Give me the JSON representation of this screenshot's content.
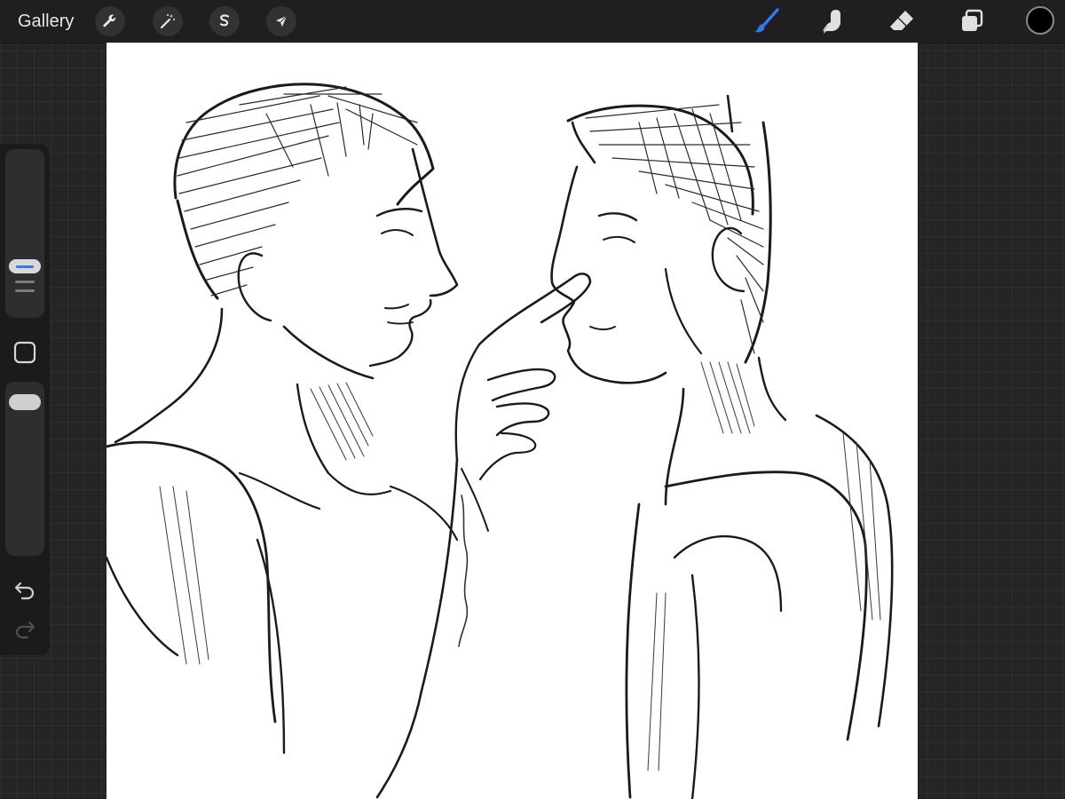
{
  "topbar": {
    "gallery_label": "Gallery",
    "left_tools": [
      {
        "name": "actions",
        "icon": "wrench-icon"
      },
      {
        "name": "adjustments",
        "icon": "magic-wand-icon"
      },
      {
        "name": "selection",
        "icon": "selection-s-icon"
      },
      {
        "name": "transform",
        "icon": "arrow-cursor-icon"
      }
    ],
    "right_tools": [
      {
        "name": "brush",
        "icon": "brush-icon",
        "active": true
      },
      {
        "name": "smudge",
        "icon": "smudge-finger-icon"
      },
      {
        "name": "eraser",
        "icon": "eraser-icon"
      },
      {
        "name": "layers",
        "icon": "layers-icon"
      }
    ],
    "current_color": "#000000"
  },
  "colors": {
    "accent": "#2f7bf0",
    "background": "#252527",
    "toolbar": "#1f1f21"
  },
  "sidebar": {
    "brush_size_level": 0.35,
    "opacity_level": 0.95,
    "icons": [
      "modify-square-icon",
      "undo-icon",
      "redo-icon"
    ]
  },
  "canvas": {
    "background": "#ffffff",
    "content": "sketch-artwork"
  }
}
